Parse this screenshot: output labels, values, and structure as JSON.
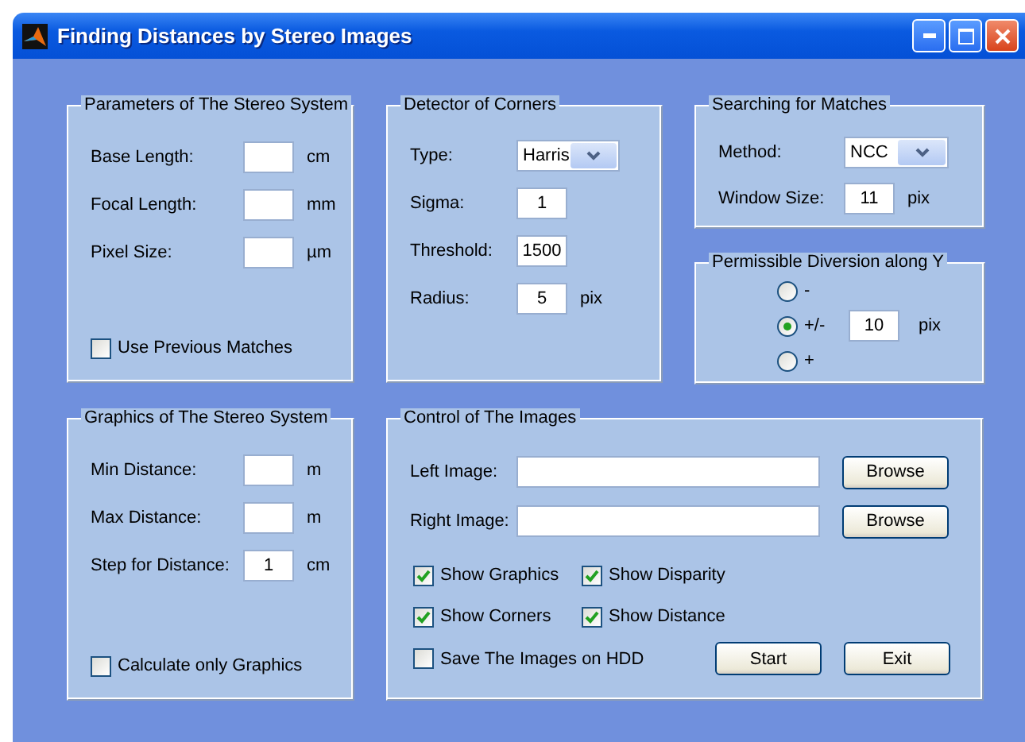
{
  "window": {
    "title": "Finding Distances by Stereo Images"
  },
  "parameters_panel": {
    "title": "Parameters of The Stereo System",
    "fields": [
      {
        "label": "Base Length:",
        "unit": "cm"
      },
      {
        "label": "Focal Length:",
        "unit": "mm"
      },
      {
        "label": "Pixel Size:",
        "unit": "µm"
      }
    ],
    "checkbox": {
      "label": "Use Previous Matches",
      "checked": false
    }
  },
  "detector_panel": {
    "title": "Detector of Corners",
    "type": {
      "label": "Type:",
      "value": "Harris"
    },
    "fields": [
      {
        "label": "Sigma:",
        "value": "1"
      },
      {
        "label": "Threshold:",
        "value": "1500"
      },
      {
        "label": "Radius:",
        "value": "5",
        "unit": "pix"
      }
    ]
  },
  "search_panel": {
    "title": "Searching for Matches",
    "method": {
      "label": "Method:",
      "value": "NCC"
    },
    "window_size": {
      "label": "Window Size:",
      "value": "11",
      "unit": "pix"
    }
  },
  "diversion_panel": {
    "title": "Permissible Diversion along Y",
    "options": [
      {
        "label": "-",
        "selected": false
      },
      {
        "label": "+/-",
        "selected": true
      },
      {
        "label": "+",
        "selected": false
      }
    ],
    "value": "10",
    "unit": "pix"
  },
  "graphics_panel": {
    "title": "Graphics of The Stereo System",
    "fields": [
      {
        "label": "Min Distance:",
        "unit": "m"
      },
      {
        "label": "Max Distance:",
        "unit": "m"
      },
      {
        "label": "Step for Distance:",
        "value": "1",
        "unit": "cm"
      }
    ],
    "checkbox": {
      "label": "Calculate only Graphics",
      "checked": false
    }
  },
  "control_panel": {
    "title": "Control of The Images",
    "files": [
      {
        "label": "Left Image:",
        "button": "Browse"
      },
      {
        "label": "Right Image:",
        "button": "Browse"
      }
    ],
    "checkboxes": [
      {
        "label": "Show Graphics",
        "checked": true
      },
      {
        "label": "Show Disparity",
        "checked": true
      },
      {
        "label": "Show Corners",
        "checked": true
      },
      {
        "label": "Show Distance",
        "checked": true
      }
    ],
    "save_checkbox": {
      "label": "Save The Images on HDD",
      "checked": false
    },
    "buttons": [
      "Start",
      "Exit"
    ]
  }
}
